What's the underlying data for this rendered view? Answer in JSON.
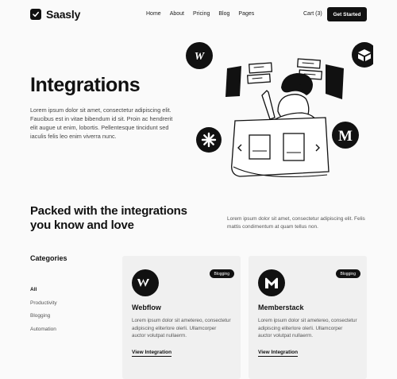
{
  "header": {
    "brand": "Saasly",
    "nav": [
      "Home",
      "About",
      "Pricing",
      "Blog",
      "Pages"
    ],
    "cart": "Cart (3)",
    "cta": "Get Started"
  },
  "hero": {
    "title": "Integrations",
    "body": "Lorem ipsum dolor sit amet, consectetur adipiscing elit. Faucibus est in vitae bibendum id sit. Proin ac hendrerit elit augue ut enim, lobortis. Pellentesque tincidunt sed iaculis felis leo enim viverra nunc.",
    "illustration_icons": [
      "webflow-icon",
      "airtable-icon",
      "zapier-icon",
      "medium-icon"
    ]
  },
  "section": {
    "title": "Packed with the integrations you know and love",
    "body": "Lorem ipsum dolor sit amet, consectetur adipiscing elit. Felis mattis condimentum at quam tellus non."
  },
  "categories": {
    "title": "Categories",
    "items": [
      "All",
      "Productivity",
      "Blogging",
      "Automation"
    ],
    "active": "All"
  },
  "cards": [
    {
      "title": "Webflow",
      "badge": "Blogging",
      "icon": "webflow-icon",
      "body": "Lorem ipsum dolor sit ametereo, consectetur adipiscing eliterlore olerli. Ullamcorper auctor volutpat nullaerm.",
      "link": "View Integration"
    },
    {
      "title": "Memberstack",
      "badge": "Blogging",
      "icon": "memberstack-icon",
      "body": "Lorem ipsum dolor sit ametereo, consectetur adipiscing eliterlore olerli. Ullamcorper auctor volutpat nullaerm.",
      "link": "View Integration"
    }
  ],
  "colors": {
    "primary": "#111111",
    "background": "#fafafa",
    "card": "#f0f0f0"
  }
}
